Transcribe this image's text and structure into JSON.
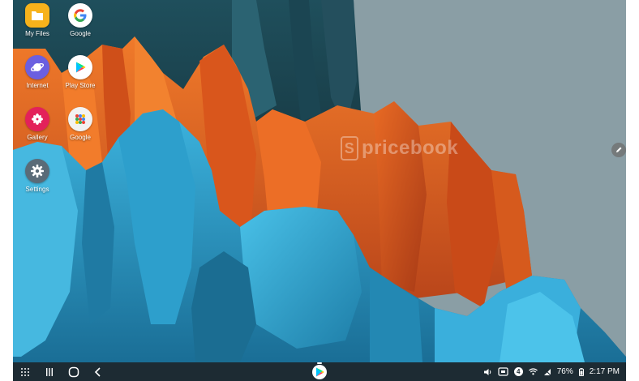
{
  "desktop": {
    "watermark": "pricebook",
    "apps": [
      {
        "label": "My Files",
        "icon": "folder-icon"
      },
      {
        "label": "Google",
        "icon": "google-icon"
      },
      {
        "label": "Internet",
        "icon": "internet-icon"
      },
      {
        "label": "Play Store",
        "icon": "play-store-icon"
      },
      {
        "label": "Gallery",
        "icon": "gallery-icon"
      },
      {
        "label": "Google",
        "icon": "google-folder-icon"
      },
      {
        "label": "Settings",
        "icon": "gear-icon"
      }
    ]
  },
  "taskbar": {
    "nav": [
      "apps-grid-icon",
      "recents-icon",
      "home-icon",
      "back-icon"
    ],
    "pinned_app": "play-store-icon",
    "status": {
      "notification_count": "4",
      "battery": "76%",
      "time": "2:17 PM"
    }
  },
  "colors": {
    "taskbar": "#1d2b33",
    "sky": "#8a9ea5",
    "orange": "#e2601f",
    "teal": "#2b9ac3"
  }
}
